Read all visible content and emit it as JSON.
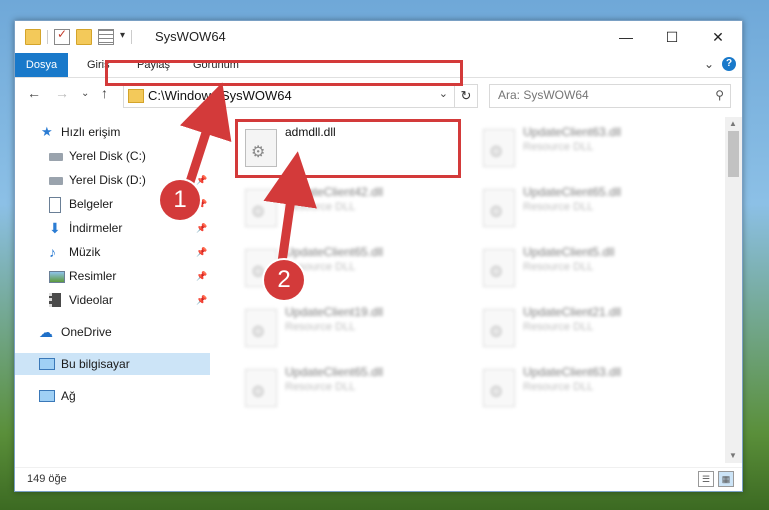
{
  "window": {
    "title": "SysWOW64",
    "controls": {
      "minimize": "—",
      "maximize": "☐",
      "close": "✕"
    }
  },
  "ribbon": {
    "tabs": [
      "Dosya",
      "Giriş",
      "Paylaş",
      "Görünüm"
    ],
    "help": "?",
    "expand": "⌄"
  },
  "navigation": {
    "back": "←",
    "forward": "→",
    "recent": "⌄",
    "up": "↑",
    "address": "C:\\Windows\\SysWOW64",
    "refresh": "↻",
    "search_placeholder": "Ara: SysWOW64"
  },
  "sidebar": {
    "items": [
      {
        "label": "Hızlı erişim",
        "icon": "star-icon",
        "pinned": false
      },
      {
        "label": "Yerel Disk (C:)",
        "icon": "drive-icon",
        "pinned": false
      },
      {
        "label": "Yerel Disk (D:)",
        "icon": "drive-icon",
        "pinned": true
      },
      {
        "label": "Belgeler",
        "icon": "documents-icon",
        "pinned": true
      },
      {
        "label": "İndirmeler",
        "icon": "download-icon",
        "pinned": true
      },
      {
        "label": "Müzik",
        "icon": "music-icon",
        "pinned": true
      },
      {
        "label": "Resimler",
        "icon": "pictures-icon",
        "pinned": true
      },
      {
        "label": "Videolar",
        "icon": "videos-icon",
        "pinned": true
      },
      {
        "label": "OneDrive",
        "icon": "cloud-icon",
        "pinned": false
      },
      {
        "label": "Bu bilgisayar",
        "icon": "computer-icon",
        "pinned": false,
        "selected": true
      },
      {
        "label": "Ağ",
        "icon": "network-icon",
        "pinned": false
      }
    ]
  },
  "files": {
    "highlighted": {
      "name": "admdll.dll",
      "type": ""
    },
    "left_column": [
      {
        "name": "UpdateClient42.dll",
        "type": "Resource DLL"
      },
      {
        "name": "UpdateClient65.dll",
        "type": "Resource DLL"
      },
      {
        "name": "UpdateClient19.dll",
        "type": "Resource DLL"
      },
      {
        "name": "UpdateClient65.dll",
        "type": "Resource DLL"
      }
    ],
    "right_column": [
      {
        "name": "UpdateClient63.dll",
        "type": "Resource DLL"
      },
      {
        "name": "UpdateClient65.dll",
        "type": "Resource DLL"
      },
      {
        "name": "UpdateClient5.dll",
        "type": "Resource DLL"
      },
      {
        "name": "UpdateClient21.dll",
        "type": "Resource DLL"
      },
      {
        "name": "UpdateClient63.dll",
        "type": "Resource DLL"
      }
    ]
  },
  "status": {
    "count": "149 öğe"
  },
  "annotations": {
    "step1": "1",
    "step2": "2",
    "color": "#d33a3a"
  }
}
